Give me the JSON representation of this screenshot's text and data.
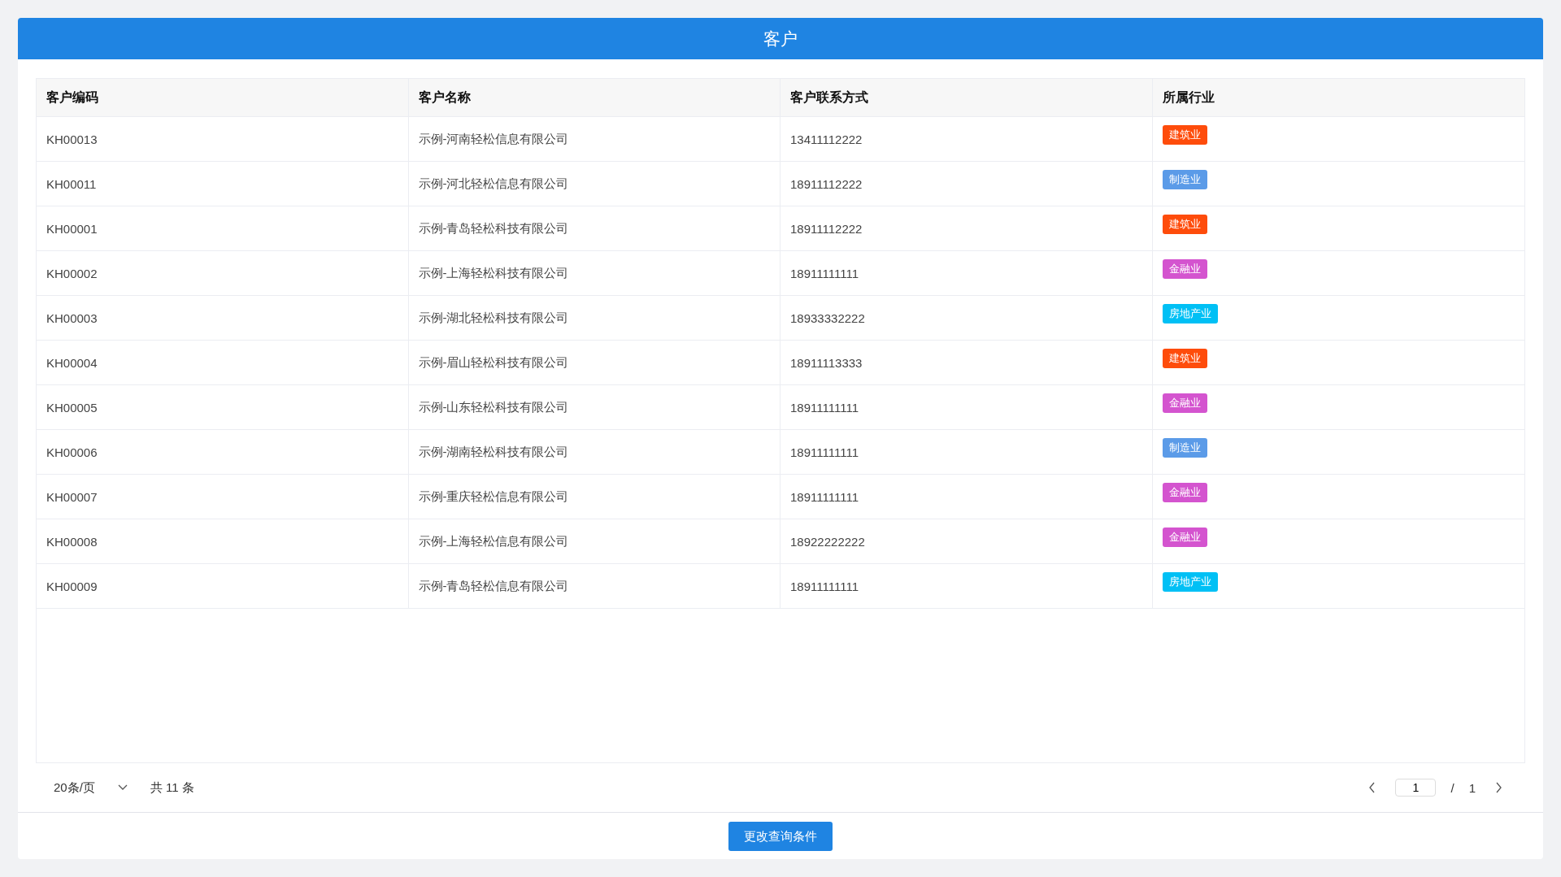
{
  "header": {
    "title": "客户"
  },
  "table": {
    "columns": [
      "客户编码",
      "客户名称",
      "客户联系方式",
      "所属行业"
    ],
    "rows": [
      {
        "code": "KH00013",
        "name": "示例-河南轻松信息有限公司",
        "phone": "13411112222",
        "industry": {
          "label": "建筑业",
          "color": "#fe4c0b"
        }
      },
      {
        "code": "KH00011",
        "name": "示例-河北轻松信息有限公司",
        "phone": "18911112222",
        "industry": {
          "label": "制造业",
          "color": "#5b9be8"
        }
      },
      {
        "code": "KH00001",
        "name": "示例-青岛轻松科技有限公司",
        "phone": "18911112222",
        "industry": {
          "label": "建筑业",
          "color": "#fe4c0b"
        }
      },
      {
        "code": "KH00002",
        "name": "示例-上海轻松科技有限公司",
        "phone": "18911111111",
        "industry": {
          "label": "金融业",
          "color": "#d454cf"
        }
      },
      {
        "code": "KH00003",
        "name": "示例-湖北轻松科技有限公司",
        "phone": "18933332222",
        "industry": {
          "label": "房地产业",
          "color": "#00c0f5"
        }
      },
      {
        "code": "KH00004",
        "name": "示例-眉山轻松科技有限公司",
        "phone": "18911113333",
        "industry": {
          "label": "建筑业",
          "color": "#fe4c0b"
        }
      },
      {
        "code": "KH00005",
        "name": "示例-山东轻松科技有限公司",
        "phone": "18911111111",
        "industry": {
          "label": "金融业",
          "color": "#d454cf"
        }
      },
      {
        "code": "KH00006",
        "name": "示例-湖南轻松科技有限公司",
        "phone": "18911111111",
        "industry": {
          "label": "制造业",
          "color": "#5b9be8"
        }
      },
      {
        "code": "KH00007",
        "name": "示例-重庆轻松信息有限公司",
        "phone": "18911111111",
        "industry": {
          "label": "金融业",
          "color": "#d454cf"
        }
      },
      {
        "code": "KH00008",
        "name": "示例-上海轻松信息有限公司",
        "phone": "18922222222",
        "industry": {
          "label": "金融业",
          "color": "#d454cf"
        }
      },
      {
        "code": "KH00009",
        "name": "示例-青岛轻松信息有限公司",
        "phone": "18911111111",
        "industry": {
          "label": "房地产业",
          "color": "#00c0f5"
        }
      }
    ]
  },
  "pagination": {
    "page_size": "20条/页",
    "total": "共 11 条",
    "page": "1",
    "separator": "/",
    "pages": "1"
  },
  "footer": {
    "button": "更改查询条件"
  }
}
